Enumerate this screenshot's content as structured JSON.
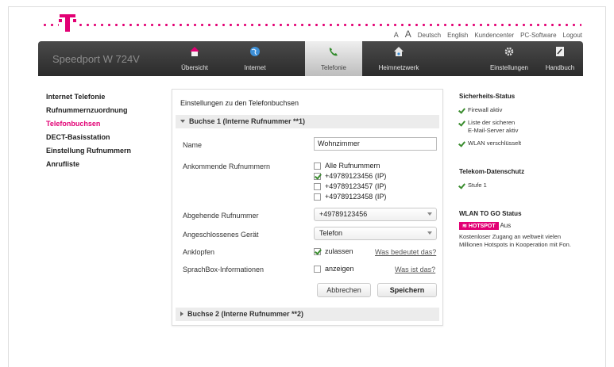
{
  "header": {
    "font_small": "A",
    "font_large": "A",
    "lang_de": "Deutsch",
    "lang_en": "English",
    "customer_center": "Kundencenter",
    "pc_software": "PC-Software",
    "logout": "Logout"
  },
  "nav": {
    "brand": "Speedport W 724V",
    "items": [
      {
        "label": "Übersicht",
        "icon": "home-icon"
      },
      {
        "label": "Internet",
        "icon": "globe-icon"
      },
      {
        "label": "Telefonie",
        "icon": "phone-icon"
      },
      {
        "label": "Heimnetzwerk",
        "icon": "home-network-icon"
      },
      {
        "label": "Einstellungen",
        "icon": "gear-icon"
      },
      {
        "label": "Handbuch",
        "icon": "manual-icon"
      }
    ]
  },
  "sidebar": {
    "items": [
      {
        "label": "Internet Telefonie"
      },
      {
        "label": "Rufnummernzuordnung"
      },
      {
        "label": "Telefonbuchsen"
      },
      {
        "label": "DECT-Basisstation"
      },
      {
        "label": "Einstellung Rufnummern"
      },
      {
        "label": "Anrufliste"
      }
    ]
  },
  "main": {
    "title": "Einstellungen zu den Telefonbuchsen",
    "section1": "Buchse 1 (Interne Rufnummer **1)",
    "section2": "Buchse 2 (Interne Rufnummer **2)",
    "name_label": "Name",
    "name_value": "Wohnzimmer",
    "incoming_label": "Ankommende Rufnummern",
    "incoming_options": [
      {
        "label": "Alle Rufnummern",
        "checked": false
      },
      {
        "label": "+49789123456 (IP)",
        "checked": true
      },
      {
        "label": "+49789123457 (IP)",
        "checked": false
      },
      {
        "label": "+49789123458 (IP)",
        "checked": false
      }
    ],
    "outgoing_label": "Abgehende Rufnummer",
    "outgoing_value": "+49789123456",
    "device_label": "Angeschlossenes Gerät",
    "device_value": "Telefon",
    "callwaiting_label": "Anklopfen",
    "callwaiting_option": "zulassen",
    "callwaiting_help": "Was bedeutet das?",
    "voicebox_label": "SprachBox-Informationen",
    "voicebox_option": "anzeigen",
    "voicebox_help": "Was ist das?",
    "cancel": "Abbrechen",
    "save": "Speichern"
  },
  "right": {
    "security_title": "Sicherheits-Status",
    "security_items": [
      "Firewall aktiv",
      "Liste der sicheren",
      "E-Mail-Server aktiv",
      "WLAN verschlüsselt"
    ],
    "privacy_title": "Telekom-Datenschutz",
    "privacy_level": "Stufe 1",
    "wlan_title": "WLAN TO GO Status",
    "hotspot_badge": "HOTSPOT",
    "hotspot_state": "Aus",
    "wlan_desc_1": "Kostenloser Zugang an weltweit vielen",
    "wlan_desc_2": "Millionen Hotspots in Kooperation mit Fon."
  },
  "colors": {
    "brand": "#e20074",
    "check": "#3a8c2e"
  }
}
